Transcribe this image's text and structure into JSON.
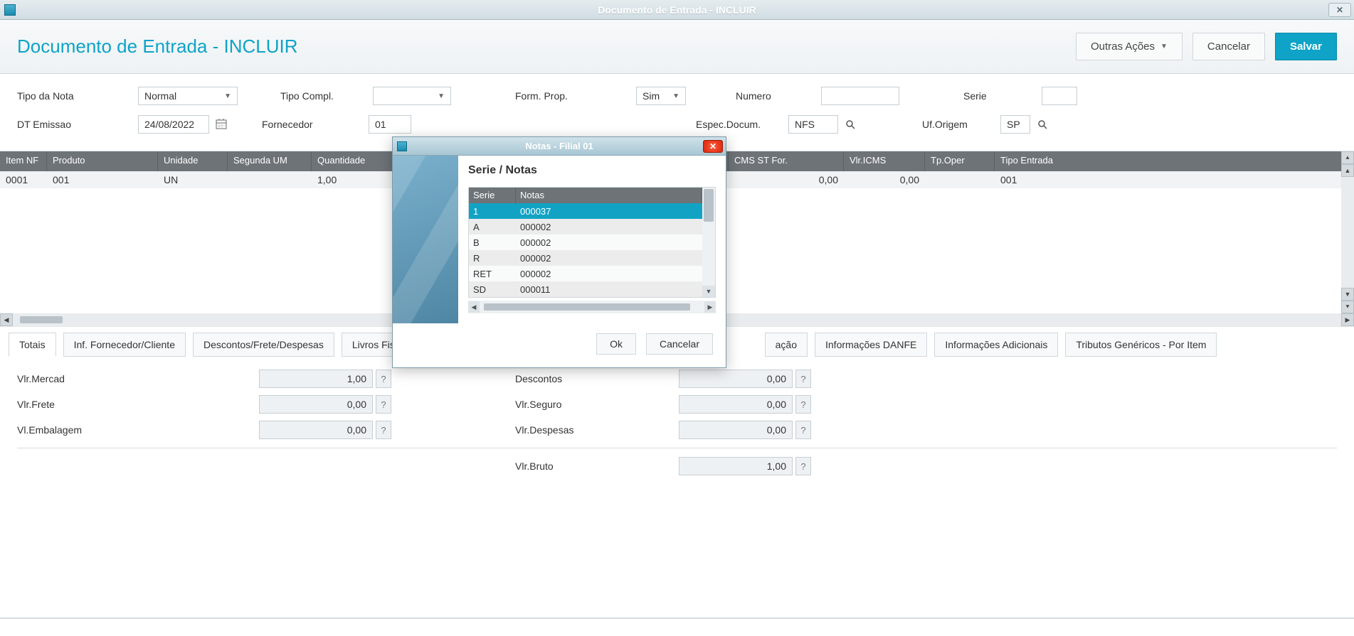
{
  "window": {
    "title": "Documento de Entrada - INCLUIR"
  },
  "header": {
    "title": "Documento de Entrada - INCLUIR",
    "other_actions": "Outras Ações",
    "cancel": "Cancelar",
    "save": "Salvar"
  },
  "form": {
    "tipo_nota": {
      "label": "Tipo da Nota",
      "value": "Normal"
    },
    "tipo_compl": {
      "label": "Tipo Compl.",
      "value": ""
    },
    "form_prop": {
      "label": "Form. Prop.",
      "value": "Sim"
    },
    "numero": {
      "label": "Numero",
      "value": ""
    },
    "serie": {
      "label": "Serie",
      "value": ""
    },
    "dt_emissao": {
      "label": "DT Emissao",
      "value": "24/08/2022"
    },
    "fornecedor": {
      "label": "Fornecedor",
      "value": "01"
    },
    "espec_docum": {
      "label": "Espec.Docum.",
      "value": "NFS"
    },
    "uf_origem": {
      "label": "Uf.Origem",
      "value": "SP"
    }
  },
  "grid": {
    "headers": [
      "Item NF",
      "Produto",
      "Unidade",
      "Segunda UM",
      "Quantidade",
      "CMS ST For.",
      "Vlr.ICMS",
      "Tp.Oper",
      "Tipo Entrada"
    ],
    "row": {
      "item_nf": "0001",
      "produto": "001",
      "unidade": "UN",
      "segunda_um": "",
      "quantidade": "1,00",
      "cms_st_for": "0,00",
      "vlr_icms": "0,00",
      "tp_oper": "",
      "tipo_entrada": "001"
    }
  },
  "tabs": [
    "Totais",
    "Inf. Fornecedor/Cliente",
    "Descontos/Frete/Despesas",
    "Livros Fiscais",
    "ação",
    "Informações DANFE",
    "Informações Adicionais",
    "Tributos Genéricos - Por Item"
  ],
  "totals": {
    "vlr_mercad": {
      "label": "Vlr.Mercad",
      "value": "1,00"
    },
    "descontos": {
      "label": "Descontos",
      "value": "0,00"
    },
    "vlr_frete": {
      "label": "Vlr.Frete",
      "value": "0,00"
    },
    "vlr_seguro": {
      "label": "Vlr.Seguro",
      "value": "0,00"
    },
    "vl_embalagem": {
      "label": "Vl.Embalagem",
      "value": "0,00"
    },
    "vlr_despesas": {
      "label": "Vlr.Despesas",
      "value": "0,00"
    },
    "vlr_bruto": {
      "label": "Vlr.Bruto",
      "value": "1,00"
    }
  },
  "modal": {
    "title": "Notas - Filial 01",
    "heading": "Serie / Notas",
    "th_serie": "Serie",
    "th_notas": "Notas",
    "rows": [
      {
        "serie": "1",
        "notas": "000037"
      },
      {
        "serie": "A",
        "notas": "000002"
      },
      {
        "serie": "B",
        "notas": "000002"
      },
      {
        "serie": "R",
        "notas": "000002"
      },
      {
        "serie": "RET",
        "notas": "000002"
      },
      {
        "serie": "SD",
        "notas": "000011"
      }
    ],
    "ok": "Ok",
    "cancel": "Cancelar"
  },
  "help": "?"
}
